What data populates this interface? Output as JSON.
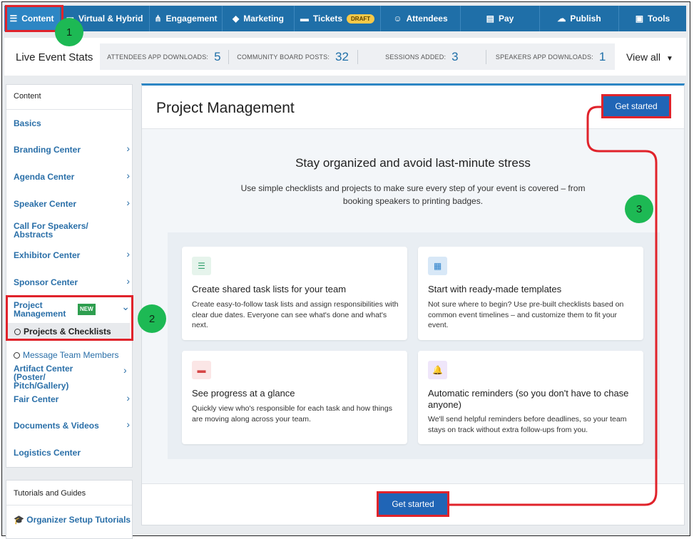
{
  "topnav": {
    "items": [
      {
        "label": "Content",
        "icon": "list-icon"
      },
      {
        "label": "Virtual & Hybrid",
        "icon": "monitor-icon"
      },
      {
        "label": "Engagement",
        "icon": "network-icon"
      },
      {
        "label": "Marketing",
        "icon": "shapes-icon"
      },
      {
        "label": "Tickets",
        "icon": "ticket-icon",
        "badge": "DRAFT"
      },
      {
        "label": "Attendees",
        "icon": "people-icon"
      },
      {
        "label": "Pay",
        "icon": "card-icon"
      },
      {
        "label": "Publish",
        "icon": "cloud-upload-icon"
      },
      {
        "label": "Tools",
        "icon": "briefcase-icon"
      }
    ]
  },
  "stats": {
    "title": "Live Event Stats",
    "items": [
      {
        "label": "ATTENDEES APP DOWNLOADS:",
        "value": "5"
      },
      {
        "label": "COMMUNITY BOARD POSTS:",
        "value": "32"
      },
      {
        "label": "SESSIONS ADDED:",
        "value": "3"
      },
      {
        "label": "SPEAKERS APP DOWNLOADS:",
        "value": "1"
      }
    ],
    "view_all": "View all"
  },
  "sidebar": {
    "heading": "Content",
    "items": [
      {
        "label": "Basics"
      },
      {
        "label": "Branding Center"
      },
      {
        "label": "Agenda Center"
      },
      {
        "label": "Speaker Center"
      },
      {
        "label": "Call For Speakers/ Abstracts"
      },
      {
        "label": "Exhibitor Center"
      },
      {
        "label": "Sponsor Center"
      },
      {
        "label": "Project Management",
        "badge": "NEW"
      },
      {
        "label": "Artifact Center (Poster/ Pitch/Gallery)"
      },
      {
        "label": "Fair Center"
      },
      {
        "label": "Documents & Videos"
      },
      {
        "label": "Logistics Center"
      }
    ],
    "subitems": [
      {
        "label": "Projects & Checklists"
      },
      {
        "label": "Message Team Members"
      }
    ],
    "tutorials_heading": "Tutorials and Guides",
    "tutorials_link": "Organizer Setup Tutorials"
  },
  "main": {
    "title": "Project Management",
    "get_started": "Get started",
    "headline": "Stay organized and avoid last-minute stress",
    "subtext": "Use simple checklists and projects to make sure every step of your event is covered – from booking speakers to printing badges.",
    "cards": [
      {
        "title": "Create shared task lists for your team",
        "text": "Create easy-to-follow task lists and assign responsibilities with clear due dates. Everyone can see what's done and what's next.",
        "icon": "list-icon",
        "color": "#2e9e6a"
      },
      {
        "title": "Start with ready-made templates",
        "text": "Not sure where to begin? Use pre-built checklists based on common event timelines – and customize them to fit your event.",
        "icon": "template-icon",
        "color": "#2a7fc9"
      },
      {
        "title": "See progress at a glance",
        "text": "Quickly view who's responsible for each task and how things are moving along across your team.",
        "icon": "chat-icon",
        "color": "#d64545"
      },
      {
        "title": "Automatic reminders (so you don't have to chase anyone)",
        "text": "We'll send helpful reminders before deadlines, so your team stays on track without extra follow-ups from you.",
        "icon": "bell-icon",
        "color": "#7a3fc9"
      }
    ]
  },
  "annotations": {
    "markers": [
      "1",
      "2",
      "3"
    ],
    "color": "#e0232b",
    "marker_color": "#1db954"
  }
}
